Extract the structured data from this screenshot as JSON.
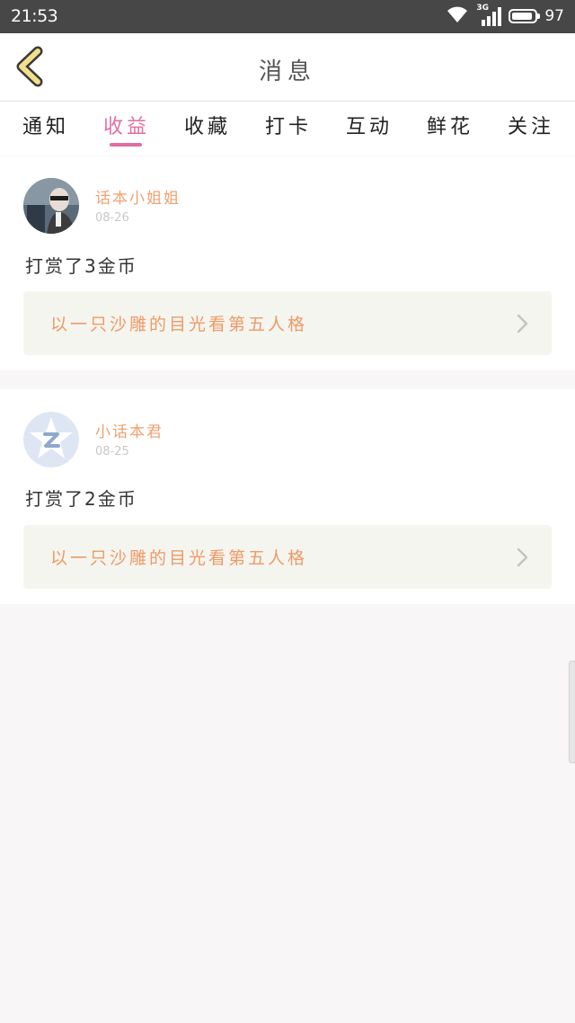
{
  "status_bar": {
    "time": "21:53",
    "network": "3G",
    "battery": "97"
  },
  "header": {
    "title": "消息"
  },
  "tabs": [
    {
      "label": "通知",
      "active": false
    },
    {
      "label": "收益",
      "active": true
    },
    {
      "label": "收藏",
      "active": false
    },
    {
      "label": "打卡",
      "active": false
    },
    {
      "label": "互动",
      "active": false
    },
    {
      "label": "鲜花",
      "active": false
    },
    {
      "label": "关注",
      "active": false
    }
  ],
  "messages": [
    {
      "username": "话本小姐姐",
      "date": "08-26",
      "reward_text": "打赏了3金币",
      "work_title": "以一只沙雕的目光看第五人格",
      "avatar": "photo-avatar"
    },
    {
      "username": "小话本君",
      "date": "08-25",
      "reward_text": "打赏了2金币",
      "work_title": "以一只沙雕的目光看第五人格",
      "avatar": "default-avatar"
    }
  ],
  "colors": {
    "accent_pink": "#e06fa3",
    "username_orange": "#f0a070",
    "link_orange": "#ee9a66",
    "back_arrow_yellow": "#f2df8a"
  }
}
